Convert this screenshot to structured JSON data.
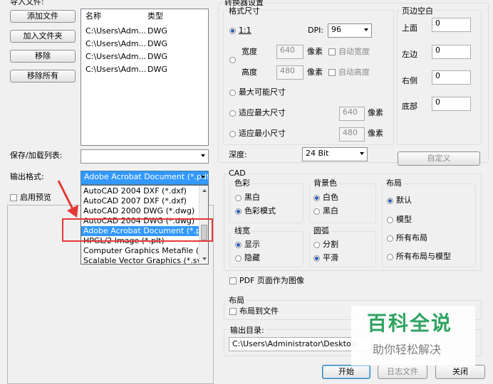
{
  "files": {
    "section_label": "导入文件:",
    "buttons": [
      "添加文件",
      "加入文件夹",
      "移除",
      "移除所有"
    ],
    "columns": [
      "名称",
      "类型"
    ],
    "rows": [
      {
        "name": "C:\\Users\\Adm...",
        "type": "DWG"
      },
      {
        "name": "C:\\Users\\Adm...",
        "type": "DWG"
      },
      {
        "name": "C:\\Users\\Adm...",
        "type": "DWG"
      },
      {
        "name": "C:\\Users\\Adm...",
        "type": "DWG"
      }
    ]
  },
  "save_load_label": "保存/加载列表:",
  "save_load_value": "",
  "output_format": {
    "label": "输出格式:",
    "selected": "Adobe Acrobat Document (*.pdf",
    "options": [
      "AutoCAD 2004 DXF (*.dxf)",
      "AutoCAD 2007 DXF (*.dxf)",
      "AutoCAD 2000 DWG (*.dwg)",
      "AutoCAD 2004 DWG (*.dwg)",
      "Adobe Acrobat Document (*.pdf)",
      "HPGL/2 Image (*.plt)",
      "Computer Graphics Metafile (*.cg",
      "Scalable Vector Graphics (*.svg)"
    ],
    "highlighted_index": 4,
    "highlight_color": "#3399ff",
    "annotation_color": "#e53935"
  },
  "preview_label": "启用预览",
  "converter": {
    "title": "转换器设置",
    "format_size": "格式尺寸",
    "ratio_label": "1:1",
    "dpi_label": "DPI:",
    "dpi_value": "96",
    "width_label": "宽度",
    "width_value": "640",
    "height_label": "高度",
    "height_value": "480",
    "pixel_label": "像素",
    "auto_width": "自动宽度",
    "auto_height": "自动高度",
    "max_size": "最大可能尺寸",
    "fit_max": "适应最大尺寸",
    "fit_max_value": "640",
    "fit_min": "适应最小尺寸",
    "fit_min_value": "480",
    "depth_label": "深度:",
    "depth_value": "24 Bit",
    "margins": {
      "title": "页边空白",
      "top": "上面",
      "top_value": "0",
      "left": "左边",
      "left_value": "0",
      "right": "右侧",
      "right_value": "0",
      "bottom": "底部",
      "bottom_value": "0"
    },
    "custom_button": "自定义"
  },
  "cad": {
    "title": "CAD",
    "color_title": "色彩",
    "bw": "黑白",
    "color_mode": "色彩模式",
    "bg_title": "背景色",
    "white": "白色",
    "black": "黑白",
    "layout_title": "布局",
    "default": "默认",
    "model": "模型",
    "all_layouts": "所有布局",
    "all_layouts_model": "所有布局与模型",
    "linewidth_title": "线宽",
    "show": "显示",
    "hide": "隐藏",
    "arc_title": "圆弧",
    "split": "分割",
    "smooth": "平滑"
  },
  "pdf_page_image": "PDF 页面作为图像",
  "layout_group": {
    "title": "布局",
    "to_file": "布局到文件"
  },
  "output_dir": {
    "label": "输出目录:",
    "value": "C:\\Users\\Administrator\\Desktop\\"
  },
  "bottom_buttons": {
    "start": "开始",
    "log": "日志文件",
    "close": "关闭"
  },
  "watermark": {
    "title": "百科全说",
    "subtitle": "助你轻松解决",
    "color": "#1f9d55"
  }
}
